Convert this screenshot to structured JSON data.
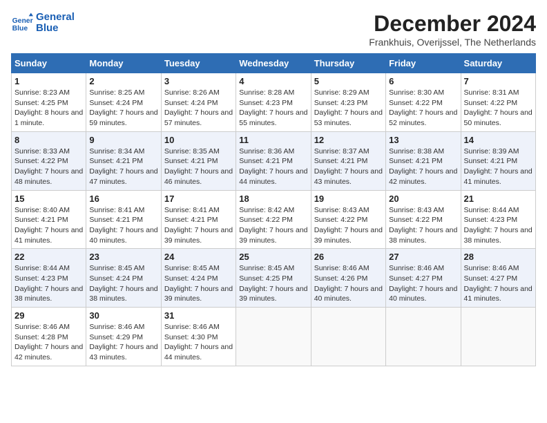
{
  "header": {
    "logo_line1": "General",
    "logo_line2": "Blue",
    "month_title": "December 2024",
    "location": "Frankhuis, Overijssel, The Netherlands"
  },
  "days_of_week": [
    "Sunday",
    "Monday",
    "Tuesday",
    "Wednesday",
    "Thursday",
    "Friday",
    "Saturday"
  ],
  "weeks": [
    [
      {
        "day": "1",
        "sunrise": "8:23 AM",
        "sunset": "4:25 PM",
        "daylight": "8 hours and 1 minute."
      },
      {
        "day": "2",
        "sunrise": "8:25 AM",
        "sunset": "4:24 PM",
        "daylight": "7 hours and 59 minutes."
      },
      {
        "day": "3",
        "sunrise": "8:26 AM",
        "sunset": "4:24 PM",
        "daylight": "7 hours and 57 minutes."
      },
      {
        "day": "4",
        "sunrise": "8:28 AM",
        "sunset": "4:23 PM",
        "daylight": "7 hours and 55 minutes."
      },
      {
        "day": "5",
        "sunrise": "8:29 AM",
        "sunset": "4:23 PM",
        "daylight": "7 hours and 53 minutes."
      },
      {
        "day": "6",
        "sunrise": "8:30 AM",
        "sunset": "4:22 PM",
        "daylight": "7 hours and 52 minutes."
      },
      {
        "day": "7",
        "sunrise": "8:31 AM",
        "sunset": "4:22 PM",
        "daylight": "7 hours and 50 minutes."
      }
    ],
    [
      {
        "day": "8",
        "sunrise": "8:33 AM",
        "sunset": "4:22 PM",
        "daylight": "7 hours and 48 minutes."
      },
      {
        "day": "9",
        "sunrise": "8:34 AM",
        "sunset": "4:21 PM",
        "daylight": "7 hours and 47 minutes."
      },
      {
        "day": "10",
        "sunrise": "8:35 AM",
        "sunset": "4:21 PM",
        "daylight": "7 hours and 46 minutes."
      },
      {
        "day": "11",
        "sunrise": "8:36 AM",
        "sunset": "4:21 PM",
        "daylight": "7 hours and 44 minutes."
      },
      {
        "day": "12",
        "sunrise": "8:37 AM",
        "sunset": "4:21 PM",
        "daylight": "7 hours and 43 minutes."
      },
      {
        "day": "13",
        "sunrise": "8:38 AM",
        "sunset": "4:21 PM",
        "daylight": "7 hours and 42 minutes."
      },
      {
        "day": "14",
        "sunrise": "8:39 AM",
        "sunset": "4:21 PM",
        "daylight": "7 hours and 41 minutes."
      }
    ],
    [
      {
        "day": "15",
        "sunrise": "8:40 AM",
        "sunset": "4:21 PM",
        "daylight": "7 hours and 41 minutes."
      },
      {
        "day": "16",
        "sunrise": "8:41 AM",
        "sunset": "4:21 PM",
        "daylight": "7 hours and 40 minutes."
      },
      {
        "day": "17",
        "sunrise": "8:41 AM",
        "sunset": "4:21 PM",
        "daylight": "7 hours and 39 minutes."
      },
      {
        "day": "18",
        "sunrise": "8:42 AM",
        "sunset": "4:22 PM",
        "daylight": "7 hours and 39 minutes."
      },
      {
        "day": "19",
        "sunrise": "8:43 AM",
        "sunset": "4:22 PM",
        "daylight": "7 hours and 39 minutes."
      },
      {
        "day": "20",
        "sunrise": "8:43 AM",
        "sunset": "4:22 PM",
        "daylight": "7 hours and 38 minutes."
      },
      {
        "day": "21",
        "sunrise": "8:44 AM",
        "sunset": "4:23 PM",
        "daylight": "7 hours and 38 minutes."
      }
    ],
    [
      {
        "day": "22",
        "sunrise": "8:44 AM",
        "sunset": "4:23 PM",
        "daylight": "7 hours and 38 minutes."
      },
      {
        "day": "23",
        "sunrise": "8:45 AM",
        "sunset": "4:24 PM",
        "daylight": "7 hours and 38 minutes."
      },
      {
        "day": "24",
        "sunrise": "8:45 AM",
        "sunset": "4:24 PM",
        "daylight": "7 hours and 39 minutes."
      },
      {
        "day": "25",
        "sunrise": "8:45 AM",
        "sunset": "4:25 PM",
        "daylight": "7 hours and 39 minutes."
      },
      {
        "day": "26",
        "sunrise": "8:46 AM",
        "sunset": "4:26 PM",
        "daylight": "7 hours and 40 minutes."
      },
      {
        "day": "27",
        "sunrise": "8:46 AM",
        "sunset": "4:27 PM",
        "daylight": "7 hours and 40 minutes."
      },
      {
        "day": "28",
        "sunrise": "8:46 AM",
        "sunset": "4:27 PM",
        "daylight": "7 hours and 41 minutes."
      }
    ],
    [
      {
        "day": "29",
        "sunrise": "8:46 AM",
        "sunset": "4:28 PM",
        "daylight": "7 hours and 42 minutes."
      },
      {
        "day": "30",
        "sunrise": "8:46 AM",
        "sunset": "4:29 PM",
        "daylight": "7 hours and 43 minutes."
      },
      {
        "day": "31",
        "sunrise": "8:46 AM",
        "sunset": "4:30 PM",
        "daylight": "7 hours and 44 minutes."
      },
      null,
      null,
      null,
      null
    ]
  ]
}
